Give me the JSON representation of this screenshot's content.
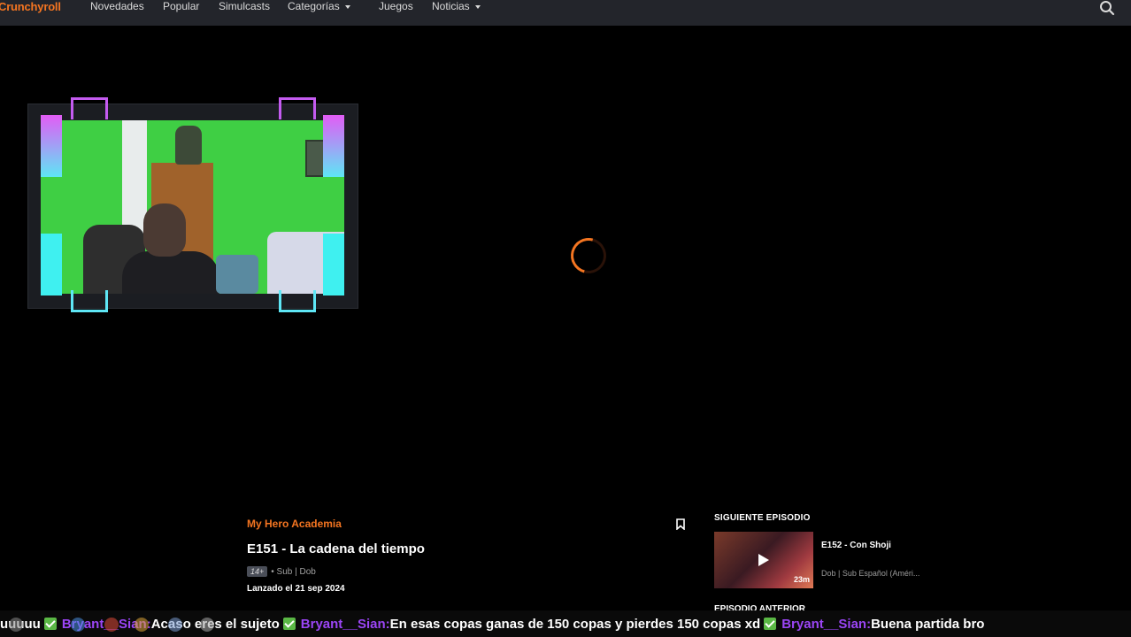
{
  "topnav": {
    "logo": "Crunchyroll",
    "items": [
      {
        "label": "Novedades",
        "dropdown": false
      },
      {
        "label": "Popular",
        "dropdown": false
      },
      {
        "label": "Simulcasts",
        "dropdown": false
      },
      {
        "label": "Categorías",
        "dropdown": true
      },
      {
        "label": "Juegos",
        "dropdown": false
      },
      {
        "label": "Noticias",
        "dropdown": true
      }
    ],
    "search_icon": "search-icon"
  },
  "player": {
    "state": "loading",
    "spinner_color": "#f47521"
  },
  "episode": {
    "series": "My Hero Academia",
    "title": "E151 - La cadena del tiempo",
    "rating": "14+",
    "audio": "• Sub | Dob",
    "release": "Lanzado el 21 sep 2024",
    "bookmark_icon": "bookmark-icon"
  },
  "next_episode": {
    "heading": "SIGUIENTE EPISODIO",
    "title": "E152 - Con Shoji",
    "duration": "23m",
    "subtitle": "Dob | Sub Español (Améri..."
  },
  "previous_episode": {
    "heading": "EPISODIO ANTERIOR"
  },
  "chat_ticker": {
    "segments": [
      {
        "type": "msg",
        "text": "uuuuu"
      },
      {
        "type": "check"
      },
      {
        "type": "user",
        "text": "Bryant__Sian:"
      },
      {
        "type": "msg",
        "text": "Acaso eres el sujeto"
      },
      {
        "type": "check"
      },
      {
        "type": "user",
        "text": "Bryant__Sian:"
      },
      {
        "type": "msg",
        "text": "En esas copas ganas de 150 copas y pierdes 150 copas xd"
      },
      {
        "type": "check"
      },
      {
        "type": "user",
        "text": "Bryant__Sian:"
      },
      {
        "type": "msg",
        "text": "Buena partida bro"
      }
    ]
  },
  "colors": {
    "brand": "#f47521",
    "nav_bg": "#23252b",
    "chat_user": "#9b45f5",
    "check": "#5ab845"
  }
}
